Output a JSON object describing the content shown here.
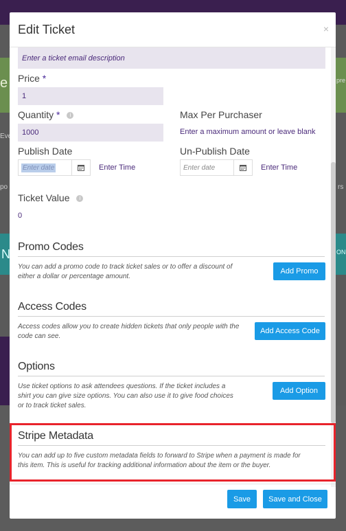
{
  "background": {
    "peek_left": "e",
    "peek_right": "pre",
    "peek_eve": "Eve",
    "peek_po": "po",
    "peek_rs": "rs",
    "peek_n": "N",
    "peek_on": "ON"
  },
  "modal": {
    "title": "Edit Ticket",
    "close_label": "×"
  },
  "form": {
    "email_description_placeholder": "Enter a ticket email description",
    "price_label": "Price",
    "price_value": "1",
    "required_mark": "*",
    "quantity_label": "Quantity",
    "quantity_value": "1000",
    "max_per_purchaser_label": "Max Per Purchaser",
    "max_per_purchaser_placeholder": "Enter a maximum amount or leave blank",
    "publish_date_label": "Publish Date",
    "publish_date_placeholder": "Enter date",
    "publish_time_label": "Enter Time",
    "unpublish_date_label": "Un-Publish Date",
    "unpublish_date_placeholder": "Enter date",
    "unpublish_time_label": "Enter Time",
    "ticket_value_label": "Ticket Value",
    "ticket_value": "0",
    "info_icon_glyph": "i"
  },
  "sections": {
    "promo": {
      "title": "Promo Codes",
      "desc_line1": "You can add a promo code to track ticket sales or to offer a discount of",
      "desc_line2": "either a dollar or percentage amount.",
      "button": "Add Promo"
    },
    "access": {
      "title": "Access Codes",
      "desc_line1": "Access codes allow you to create hidden tickets that only people with the",
      "desc_line2": "code can see.",
      "button": "Add Access Code"
    },
    "options": {
      "title": "Options",
      "desc_line1": "Use ticket options to ask attendees questions. If the ticket includes a",
      "desc_line2": "shirt you can give size options. You can also use it to give food choices",
      "desc_line3": "or to track ticket sales.",
      "button": "Add Option"
    },
    "stripe": {
      "title": "Stripe Metadata",
      "desc_line1": "You can add up to five custom metadata fields to forward to Stripe when a payment is made for",
      "desc_line2": "this item. This is useful for tracking additional information about the item or the buyer."
    }
  },
  "footer": {
    "save": "Save",
    "save_close": "Save and Close"
  },
  "colors": {
    "accent_button": "#1a9be6",
    "highlight": "#e8232b",
    "input_bg": "#e8e4ee",
    "input_text": "#4a2a7a"
  }
}
